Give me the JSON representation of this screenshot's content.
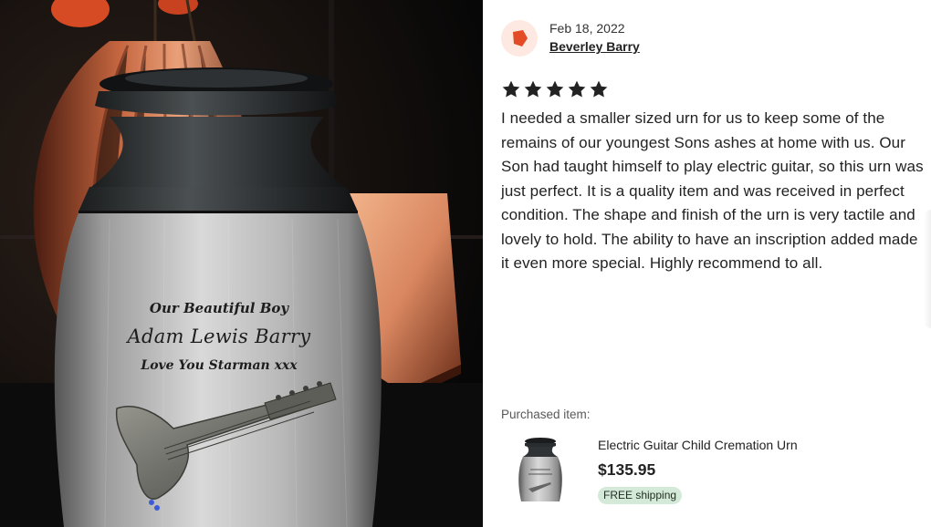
{
  "photo": {
    "engraving": {
      "line1": "Our Beautiful Boy",
      "line2": "Adam Lewis Barry",
      "line3": "Love You Starman xxx"
    }
  },
  "review": {
    "avatar_icon": "reviewer-avatar-pentagon",
    "accent_color": "#e24b26",
    "date": "Feb 18, 2022",
    "reviewer": "Beverley Barry",
    "rating": 5,
    "text": "I needed a smaller sized urn for us to keep some of the remains of our youngest Sons ashes at home with us. Our Son had taught himself to play electric guitar, so this urn was just perfect. It is a quality item and was received in perfect condition. The shape and finish of the urn is very tactile and lovely to hold. The ability to have an inscription added made it even more special. Highly recommend to all."
  },
  "purchased": {
    "label": "Purchased item:",
    "title": "Electric Guitar Child Cremation Urn",
    "price": "$135.95",
    "shipping_badge": "FREE shipping",
    "badge_color": "#d4e9d7"
  }
}
